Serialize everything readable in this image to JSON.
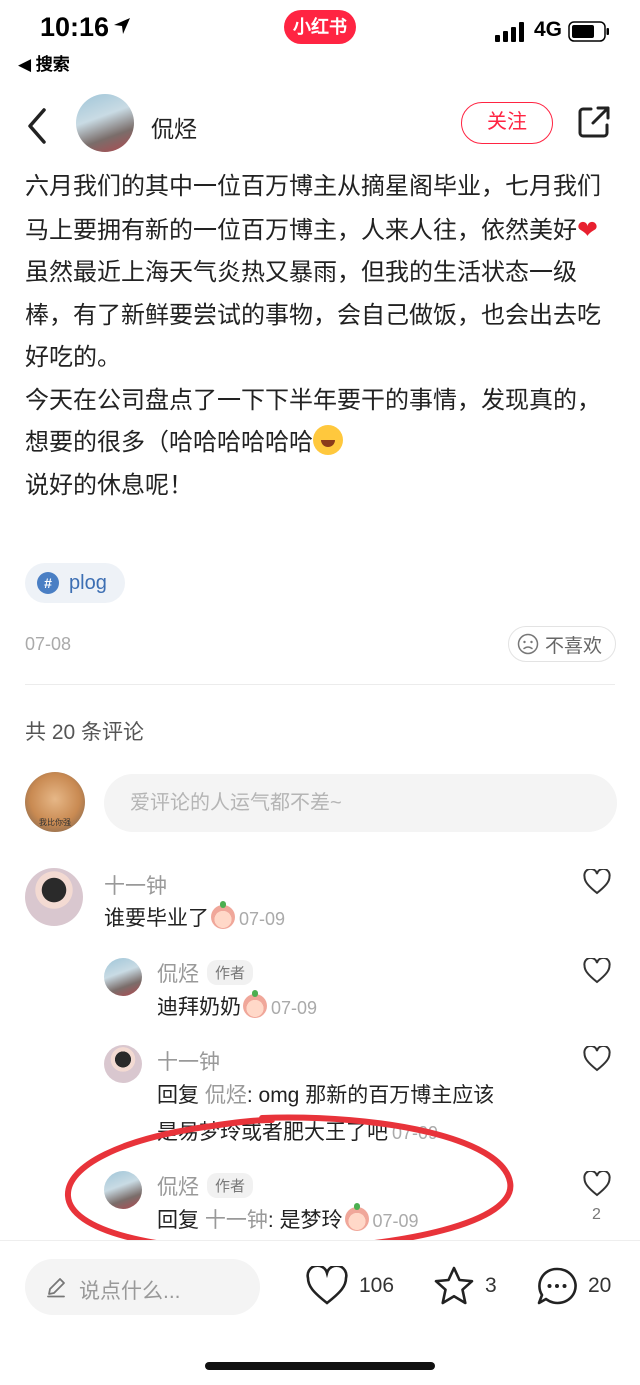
{
  "status_bar": {
    "time": "10:16",
    "brand": "小红书",
    "network": "4G",
    "back_app": "◀ 搜索"
  },
  "header": {
    "author_name": "侃烃",
    "follow_label": "关注"
  },
  "post": {
    "paragraphs": [
      "六月我们的其中一位百万博主从摘星阁毕业，七月我们马上要拥有新的一位百万博主，人来人往，依然美好",
      "虽然最近上海天气炎热又暴雨，但我的生活状态一级棒，有了新鲜要尝试的事物，会自己做饭，也会出去吃好吃的。",
      "今天在公司盘点了一下下半年要干的事情，发现真的，想要的很多（哈哈哈哈哈哈",
      "说好的休息呢！"
    ],
    "tag": "plog",
    "date": "07-08",
    "dislike_label": "不喜欢"
  },
  "comments_section": {
    "count_label": "共 20 条评论",
    "my_avatar_caption": "我比你强",
    "input_placeholder": "爱评论的人运气都不差~"
  },
  "comments": [
    {
      "name": "十一钟",
      "text": "谁要毕业了",
      "date": "07-09"
    },
    {
      "name": "侃烃",
      "badge": "作者",
      "text": "迪拜奶奶",
      "date": "07-09"
    },
    {
      "name": "十一钟",
      "reply_prefix": "回复",
      "reply_to": "侃烃",
      "text_line1": ": omg 那新的百万博主应该",
      "text_line2": "是易梦玲或者肥大王了吧",
      "date": "07-09"
    },
    {
      "name": "侃烃",
      "badge": "作者",
      "reply_prefix": "回复",
      "reply_to": "十一钟",
      "text": ": 是梦玲",
      "date": "07-09",
      "likes": "2"
    }
  ],
  "bottom_bar": {
    "input_placeholder": "说点什么...",
    "likes": "106",
    "collects": "3",
    "comments": "20"
  },
  "colors": {
    "brand_red": "#ff2442",
    "annotation_red": "#e8333a"
  }
}
